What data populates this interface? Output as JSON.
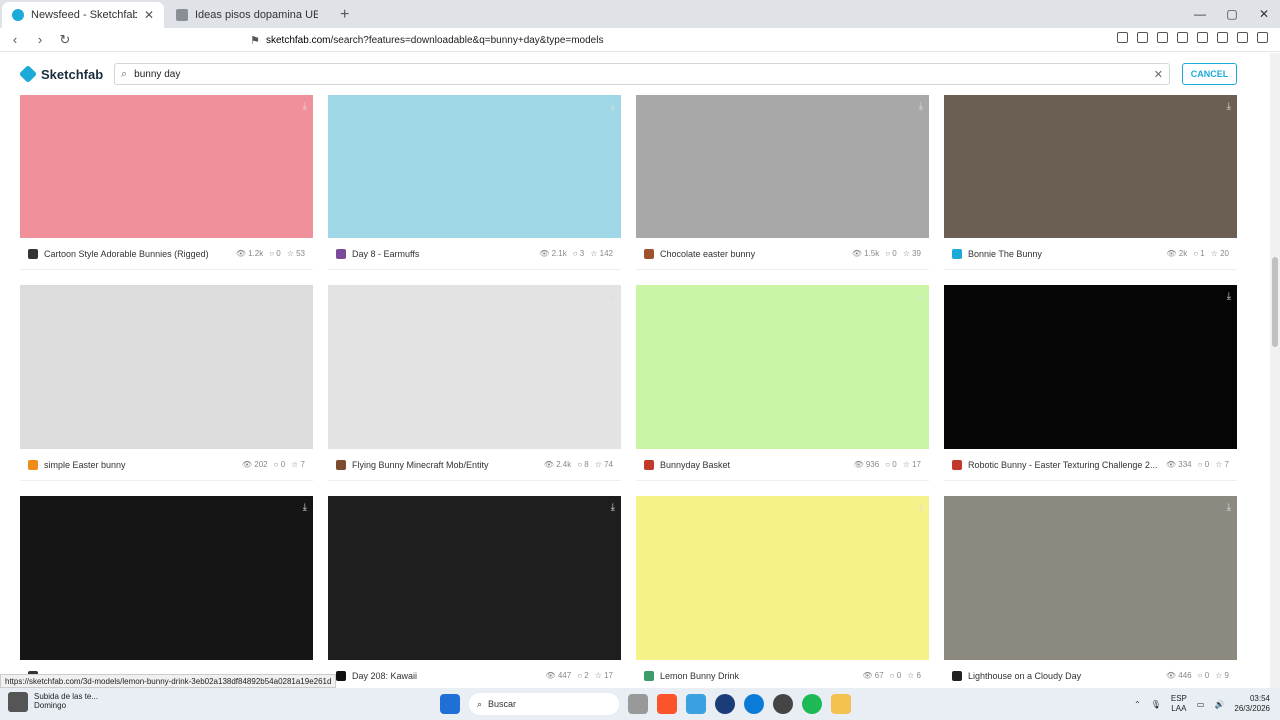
{
  "browser": {
    "tabs": [
      {
        "title": "Newsfeed - Sketchfab",
        "active": true
      },
      {
        "title": "Ideas pisos dopamina UEFN",
        "active": false
      }
    ],
    "url_host": "sketchfab.com",
    "url_path": "/search?features=downloadable&q=bunny+day&type=models",
    "status_url": "https://sketchfab.com/3d-models/lemon-bunny-drink-3eb02a138df84892b54a0281a19e261d"
  },
  "sketchfab": {
    "brand": "Sketchfab",
    "search_value": "bunny day",
    "cancel_label": "CANCEL"
  },
  "models": [
    {
      "name": "Cartoon Style Adorable Bunnies (Rigged)",
      "views": "1.2k",
      "comments": "0",
      "likes": "53",
      "bg": "#f0909a",
      "avatar": "#333"
    },
    {
      "name": "Day 8 - Earmuffs",
      "views": "2.1k",
      "comments": "3",
      "likes": "142",
      "bg": "#9fd7e6",
      "avatar": "#7a4b9b"
    },
    {
      "name": "Chocolate easter bunny",
      "views": "1.5k",
      "comments": "0",
      "likes": "39",
      "bg": "#a8a8a8",
      "avatar": "#a0522d"
    },
    {
      "name": "Bonnie The Bunny",
      "views": "2k",
      "comments": "1",
      "likes": "20",
      "bg": "#6b5e52",
      "avatar": "#1caad9"
    },
    {
      "name": "simple Easter bunny",
      "views": "202",
      "comments": "0",
      "likes": "7",
      "bg": "#dcdcdc",
      "avatar": "#f08c1a"
    },
    {
      "name": "Flying Bunny Minecraft Mob/Entity",
      "views": "2.4k",
      "comments": "8",
      "likes": "74",
      "bg": "#e3e3e3",
      "avatar": "#7a4b2e"
    },
    {
      "name": "Bunnyday Basket",
      "views": "936",
      "comments": "0",
      "likes": "17",
      "bg": "#c8f5a6",
      "avatar": "#c0392b"
    },
    {
      "name": "Robotic Bunny - Easter Texturing Challenge 2...",
      "views": "334",
      "comments": "0",
      "likes": "7",
      "bg": "#050505",
      "avatar": "#c0392b"
    },
    {
      "name": "",
      "views": "",
      "comments": "",
      "likes": "",
      "bg": "#151515",
      "avatar": "#333"
    },
    {
      "name": "Day 208: Kawaii",
      "views": "447",
      "comments": "2",
      "likes": "17",
      "bg": "#1e1e1e",
      "avatar": "#111"
    },
    {
      "name": "Lemon Bunny Drink",
      "views": "67",
      "comments": "0",
      "likes": "6",
      "bg": "#f5f28a",
      "avatar": "#3a9d6a"
    },
    {
      "name": "Lighthouse on a Cloudy Day",
      "views": "446",
      "comments": "0",
      "likes": "9",
      "bg": "#8c8a80",
      "avatar": "#222"
    }
  ],
  "taskbar": {
    "notification_title": "Subida de las te...",
    "notification_sub": "Domingo",
    "search_label": "Buscar",
    "lang1": "ESP",
    "lang2": "LAA",
    "time": "03:54",
    "date": "26/3/2026"
  }
}
